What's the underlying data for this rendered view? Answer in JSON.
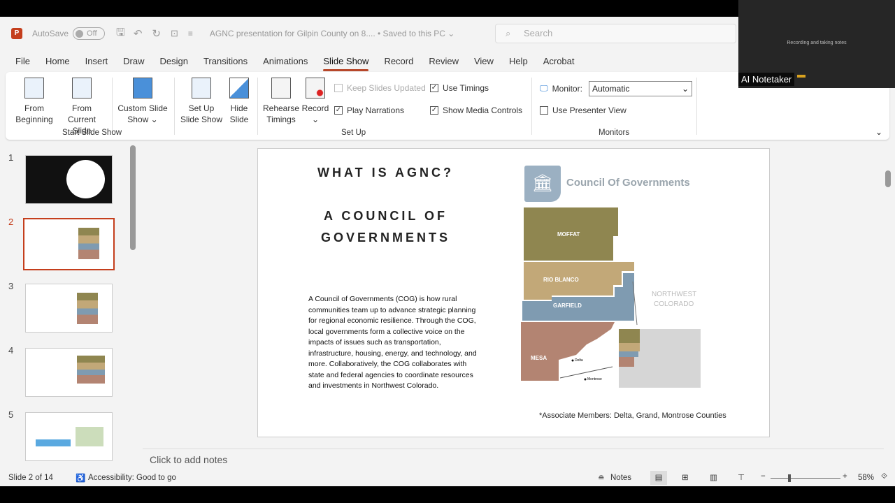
{
  "titlebar": {
    "autosave": "AutoSave",
    "toggle": "Off",
    "doc_title": "AGNC presentation for Gilpin County on 8.... • Saved to this PC ⌄",
    "search_placeholder": "Search"
  },
  "tabs": [
    "File",
    "Home",
    "Insert",
    "Draw",
    "Design",
    "Transitions",
    "Animations",
    "Slide Show",
    "Record",
    "Review",
    "View",
    "Help",
    "Acrobat"
  ],
  "active_tab": "Slide Show",
  "ribbon": {
    "from_beginning": [
      "From",
      "Beginning"
    ],
    "from_current": [
      "From",
      "Current Slide"
    ],
    "custom": [
      "Custom Slide",
      "Show ⌄"
    ],
    "group_start": "Start Slide Show",
    "setup_show": [
      "Set Up",
      "Slide Show"
    ],
    "hide": [
      "Hide",
      "Slide"
    ],
    "rehearse": [
      "Rehearse",
      "Timings"
    ],
    "record": [
      "Record",
      "⌄"
    ],
    "keep_updated": "Keep Slides Updated",
    "use_timings": "Use Timings",
    "play_narrations": "Play Narrations",
    "show_media": "Show Media Controls",
    "group_setup": "Set Up",
    "monitor_label": "Monitor:",
    "monitor_value": "Automatic",
    "presenter_view": "Use Presenter View",
    "group_monitors": "Monitors"
  },
  "checkboxes": {
    "keep_updated": false,
    "use_timings": true,
    "play_narrations": true,
    "show_media": true,
    "presenter_view": false
  },
  "thumbnails": [
    "1",
    "2",
    "3",
    "4",
    "5"
  ],
  "selected_slide": 2,
  "slide": {
    "title": "WHAT IS AGNC?",
    "subtitle1": "A COUNCIL OF",
    "subtitle2": "GOVERNMENTS",
    "body": "A Council of Governments (COG) is how rural communities team up to advance strategic planning for regional economic resilience. Through the COG, local governments form a collective voice on the impacts of issues such as transportation, infrastructure, housing, energy, and technology, and more. Collaboratively, the COG collaborates with state and federal agencies to coordinate resources and investments in Northwest Colorado.",
    "logo_text": "Council Of Governments",
    "counties": [
      "MOFFAT",
      "RIO BLANCO",
      "GARFIELD",
      "MESA"
    ],
    "region": [
      "NORTHWEST",
      "COLORADO"
    ],
    "cities": [
      "Delta",
      "Montrose"
    ],
    "footnote": "*Associate Members: Delta, Grand, Montrose Counties",
    "colors": {
      "moffat": "#8f8650",
      "rio_blanco": "#c2a878",
      "garfield": "#7f9bb1",
      "mesa": "#b38472",
      "logo": "#9bb0c2"
    }
  },
  "notes_placeholder": "Click to add notes",
  "status": {
    "slide": "Slide 2 of 14",
    "accessibility": "Accessibility: Good to go",
    "notes": "Notes",
    "zoom": "58%"
  },
  "overlay": {
    "message": "Recording and taking notes",
    "name": "AI Notetaker"
  }
}
